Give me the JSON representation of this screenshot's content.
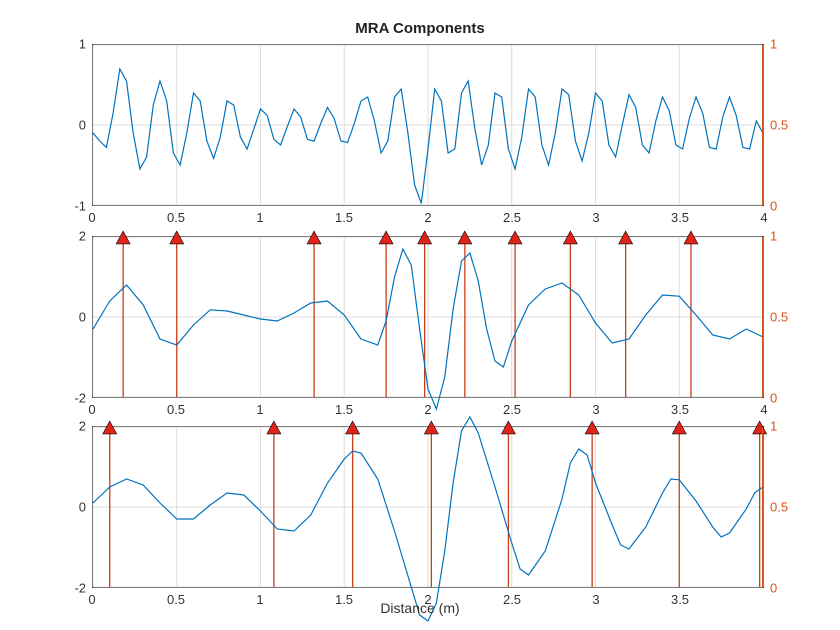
{
  "title": "MRA Components",
  "xlabel": "Distance (m)",
  "colors": {
    "signal": "#0072bd",
    "stem": "#c93e16",
    "marker": "#e2231a"
  },
  "chart_data": [
    {
      "type": "line",
      "xlim": [
        0,
        4
      ],
      "ylim_left": [
        -1,
        1
      ],
      "yticks_left": [
        -1,
        0,
        1
      ],
      "ylim_right": [
        0,
        1
      ],
      "yticks_right": [
        0,
        0.5,
        1
      ],
      "xticks": [
        0,
        0.5,
        1,
        1.5,
        2,
        2.5,
        3,
        3.5,
        4
      ],
      "signal": [
        [
          0.0,
          -0.1
        ],
        [
          0.04,
          -0.2
        ],
        [
          0.08,
          -0.28
        ],
        [
          0.12,
          0.15
        ],
        [
          0.16,
          0.7
        ],
        [
          0.2,
          0.55
        ],
        [
          0.24,
          -0.1
        ],
        [
          0.28,
          -0.55
        ],
        [
          0.32,
          -0.4
        ],
        [
          0.36,
          0.25
        ],
        [
          0.4,
          0.55
        ],
        [
          0.44,
          0.3
        ],
        [
          0.48,
          -0.35
        ],
        [
          0.52,
          -0.5
        ],
        [
          0.56,
          -0.1
        ],
        [
          0.6,
          0.4
        ],
        [
          0.64,
          0.3
        ],
        [
          0.68,
          -0.2
        ],
        [
          0.72,
          -0.42
        ],
        [
          0.76,
          -0.15
        ],
        [
          0.8,
          0.3
        ],
        [
          0.84,
          0.25
        ],
        [
          0.88,
          -0.15
        ],
        [
          0.92,
          -0.3
        ],
        [
          0.96,
          -0.05
        ],
        [
          1.0,
          0.2
        ],
        [
          1.04,
          0.12
        ],
        [
          1.08,
          -0.18
        ],
        [
          1.12,
          -0.25
        ],
        [
          1.16,
          -0.02
        ],
        [
          1.2,
          0.2
        ],
        [
          1.24,
          0.1
        ],
        [
          1.28,
          -0.18
        ],
        [
          1.32,
          -0.2
        ],
        [
          1.36,
          0.02
        ],
        [
          1.4,
          0.22
        ],
        [
          1.44,
          0.08
        ],
        [
          1.48,
          -0.2
        ],
        [
          1.52,
          -0.22
        ],
        [
          1.56,
          0.02
        ],
        [
          1.6,
          0.3
        ],
        [
          1.64,
          0.35
        ],
        [
          1.68,
          0.05
        ],
        [
          1.72,
          -0.35
        ],
        [
          1.76,
          -0.2
        ],
        [
          1.8,
          0.35
        ],
        [
          1.84,
          0.45
        ],
        [
          1.88,
          -0.1
        ],
        [
          1.92,
          -0.75
        ],
        [
          1.96,
          -0.98
        ],
        [
          2.0,
          -0.3
        ],
        [
          2.04,
          0.45
        ],
        [
          2.08,
          0.3
        ],
        [
          2.12,
          -0.35
        ],
        [
          2.16,
          -0.3
        ],
        [
          2.2,
          0.4
        ],
        [
          2.24,
          0.55
        ],
        [
          2.28,
          -0.05
        ],
        [
          2.32,
          -0.5
        ],
        [
          2.36,
          -0.25
        ],
        [
          2.4,
          0.4
        ],
        [
          2.44,
          0.35
        ],
        [
          2.48,
          -0.3
        ],
        [
          2.52,
          -0.55
        ],
        [
          2.56,
          -0.15
        ],
        [
          2.6,
          0.45
        ],
        [
          2.64,
          0.35
        ],
        [
          2.68,
          -0.25
        ],
        [
          2.72,
          -0.5
        ],
        [
          2.76,
          -0.1
        ],
        [
          2.8,
          0.45
        ],
        [
          2.84,
          0.38
        ],
        [
          2.88,
          -0.2
        ],
        [
          2.92,
          -0.45
        ],
        [
          2.96,
          -0.1
        ],
        [
          3.0,
          0.4
        ],
        [
          3.04,
          0.3
        ],
        [
          3.08,
          -0.25
        ],
        [
          3.12,
          -0.4
        ],
        [
          3.16,
          0.0
        ],
        [
          3.2,
          0.38
        ],
        [
          3.24,
          0.22
        ],
        [
          3.28,
          -0.25
        ],
        [
          3.32,
          -0.35
        ],
        [
          3.36,
          0.05
        ],
        [
          3.4,
          0.35
        ],
        [
          3.44,
          0.18
        ],
        [
          3.48,
          -0.25
        ],
        [
          3.52,
          -0.3
        ],
        [
          3.56,
          0.08
        ],
        [
          3.6,
          0.35
        ],
        [
          3.64,
          0.15
        ],
        [
          3.68,
          -0.28
        ],
        [
          3.72,
          -0.3
        ],
        [
          3.76,
          0.1
        ],
        [
          3.8,
          0.35
        ],
        [
          3.84,
          0.12
        ],
        [
          3.88,
          -0.28
        ],
        [
          3.92,
          -0.3
        ],
        [
          3.96,
          0.05
        ],
        [
          4.0,
          -0.1
        ]
      ],
      "stems": []
    },
    {
      "type": "line",
      "xlim": [
        0,
        4
      ],
      "ylim_left": [
        -2,
        2
      ],
      "yticks_left": [
        -2,
        0,
        2
      ],
      "ylim_right": [
        0,
        1
      ],
      "yticks_right": [
        0,
        0.5,
        1
      ],
      "xticks": [
        0,
        0.5,
        1,
        1.5,
        2,
        2.5,
        3,
        3.5,
        4
      ],
      "signal": [
        [
          0.0,
          -0.3
        ],
        [
          0.1,
          0.4
        ],
        [
          0.2,
          0.8
        ],
        [
          0.3,
          0.3
        ],
        [
          0.4,
          -0.55
        ],
        [
          0.5,
          -0.7
        ],
        [
          0.6,
          -0.2
        ],
        [
          0.7,
          0.18
        ],
        [
          0.8,
          0.15
        ],
        [
          0.9,
          0.05
        ],
        [
          1.0,
          -0.05
        ],
        [
          1.1,
          -0.1
        ],
        [
          1.2,
          0.1
        ],
        [
          1.3,
          0.35
        ],
        [
          1.4,
          0.4
        ],
        [
          1.5,
          0.05
        ],
        [
          1.6,
          -0.55
        ],
        [
          1.7,
          -0.7
        ],
        [
          1.75,
          -0.1
        ],
        [
          1.8,
          1.0
        ],
        [
          1.85,
          1.7
        ],
        [
          1.9,
          1.3
        ],
        [
          1.95,
          -0.3
        ],
        [
          2.0,
          -1.8
        ],
        [
          2.05,
          -2.3
        ],
        [
          2.1,
          -1.5
        ],
        [
          2.15,
          0.2
        ],
        [
          2.2,
          1.4
        ],
        [
          2.25,
          1.6
        ],
        [
          2.3,
          0.9
        ],
        [
          2.35,
          -0.3
        ],
        [
          2.4,
          -1.1
        ],
        [
          2.45,
          -1.25
        ],
        [
          2.5,
          -0.6
        ],
        [
          2.6,
          0.3
        ],
        [
          2.7,
          0.7
        ],
        [
          2.8,
          0.85
        ],
        [
          2.9,
          0.55
        ],
        [
          3.0,
          -0.15
        ],
        [
          3.1,
          -0.65
        ],
        [
          3.2,
          -0.55
        ],
        [
          3.3,
          0.05
        ],
        [
          3.4,
          0.55
        ],
        [
          3.5,
          0.52
        ],
        [
          3.6,
          0.05
        ],
        [
          3.7,
          -0.45
        ],
        [
          3.8,
          -0.55
        ],
        [
          3.9,
          -0.3
        ],
        [
          4.0,
          -0.5
        ]
      ],
      "stems": [
        0.18,
        0.5,
        1.32,
        1.75,
        1.98,
        2.22,
        2.52,
        2.85,
        3.18,
        3.57
      ]
    },
    {
      "type": "line",
      "xlim": [
        0,
        4
      ],
      "ylim_left": [
        -2,
        2
      ],
      "yticks_left": [
        -2,
        0,
        2
      ],
      "ylim_right": [
        0,
        1
      ],
      "yticks_right": [
        0,
        0.5,
        1
      ],
      "xticks": [
        0,
        0.5,
        1,
        1.5,
        2,
        2.5,
        3,
        3.5
      ],
      "signal": [
        [
          0.0,
          0.1
        ],
        [
          0.1,
          0.5
        ],
        [
          0.2,
          0.7
        ],
        [
          0.3,
          0.55
        ],
        [
          0.4,
          0.1
        ],
        [
          0.5,
          -0.3
        ],
        [
          0.6,
          -0.3
        ],
        [
          0.7,
          0.05
        ],
        [
          0.8,
          0.35
        ],
        [
          0.9,
          0.3
        ],
        [
          1.0,
          -0.1
        ],
        [
          1.1,
          -0.55
        ],
        [
          1.2,
          -0.6
        ],
        [
          1.3,
          -0.2
        ],
        [
          1.4,
          0.6
        ],
        [
          1.5,
          1.2
        ],
        [
          1.55,
          1.4
        ],
        [
          1.6,
          1.35
        ],
        [
          1.7,
          0.7
        ],
        [
          1.8,
          -0.6
        ],
        [
          1.9,
          -2.0
        ],
        [
          1.95,
          -2.7
        ],
        [
          2.0,
          -2.85
        ],
        [
          2.05,
          -2.4
        ],
        [
          2.1,
          -1.1
        ],
        [
          2.15,
          0.6
        ],
        [
          2.2,
          1.9
        ],
        [
          2.25,
          2.25
        ],
        [
          2.3,
          1.85
        ],
        [
          2.4,
          0.5
        ],
        [
          2.5,
          -0.9
        ],
        [
          2.55,
          -1.55
        ],
        [
          2.6,
          -1.7
        ],
        [
          2.7,
          -1.1
        ],
        [
          2.8,
          0.2
        ],
        [
          2.85,
          1.1
        ],
        [
          2.9,
          1.45
        ],
        [
          2.95,
          1.3
        ],
        [
          3.0,
          0.6
        ],
        [
          3.1,
          -0.45
        ],
        [
          3.15,
          -0.95
        ],
        [
          3.2,
          -1.05
        ],
        [
          3.3,
          -0.5
        ],
        [
          3.4,
          0.35
        ],
        [
          3.45,
          0.7
        ],
        [
          3.5,
          0.68
        ],
        [
          3.6,
          0.15
        ],
        [
          3.7,
          -0.5
        ],
        [
          3.75,
          -0.75
        ],
        [
          3.8,
          -0.65
        ],
        [
          3.9,
          -0.05
        ],
        [
          3.95,
          0.35
        ],
        [
          4.0,
          0.5
        ]
      ],
      "stems": [
        0.1,
        1.08,
        1.55,
        2.02,
        2.48,
        2.98,
        3.5,
        3.98
      ]
    }
  ]
}
